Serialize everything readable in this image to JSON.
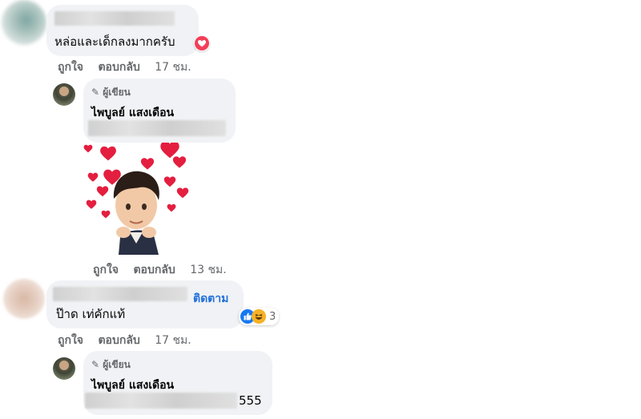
{
  "comment1": {
    "text": "หล่อและเด็กลงมากครับ",
    "actions": {
      "like": "ถูกใจ",
      "reply": "ตอบกลับ",
      "time": "17 ชม."
    }
  },
  "reply1": {
    "author_tag": "ผู้เขียน",
    "name": "ไพบูลย์ แสงเดือน",
    "actions": {
      "like": "ถูกใจ",
      "reply": "ตอบกลับ",
      "time": "13 ชม."
    }
  },
  "comment2": {
    "follow": "ติดตาม",
    "text": "ป๊าด เท่คักแท้",
    "reaction_count": "3",
    "actions": {
      "like": "ถูกใจ",
      "reply": "ตอบกลับ",
      "time": "17 ชม."
    }
  },
  "reply2": {
    "author_tag": "ผู้เขียน",
    "name": "ไพบูลย์ แสงเดือน",
    "text_suffix": "555"
  },
  "colors": {
    "link_blue": "#216fdb",
    "bubble": "#f0f2f5",
    "muted": "#65676b",
    "heart": "#e41e3f"
  }
}
